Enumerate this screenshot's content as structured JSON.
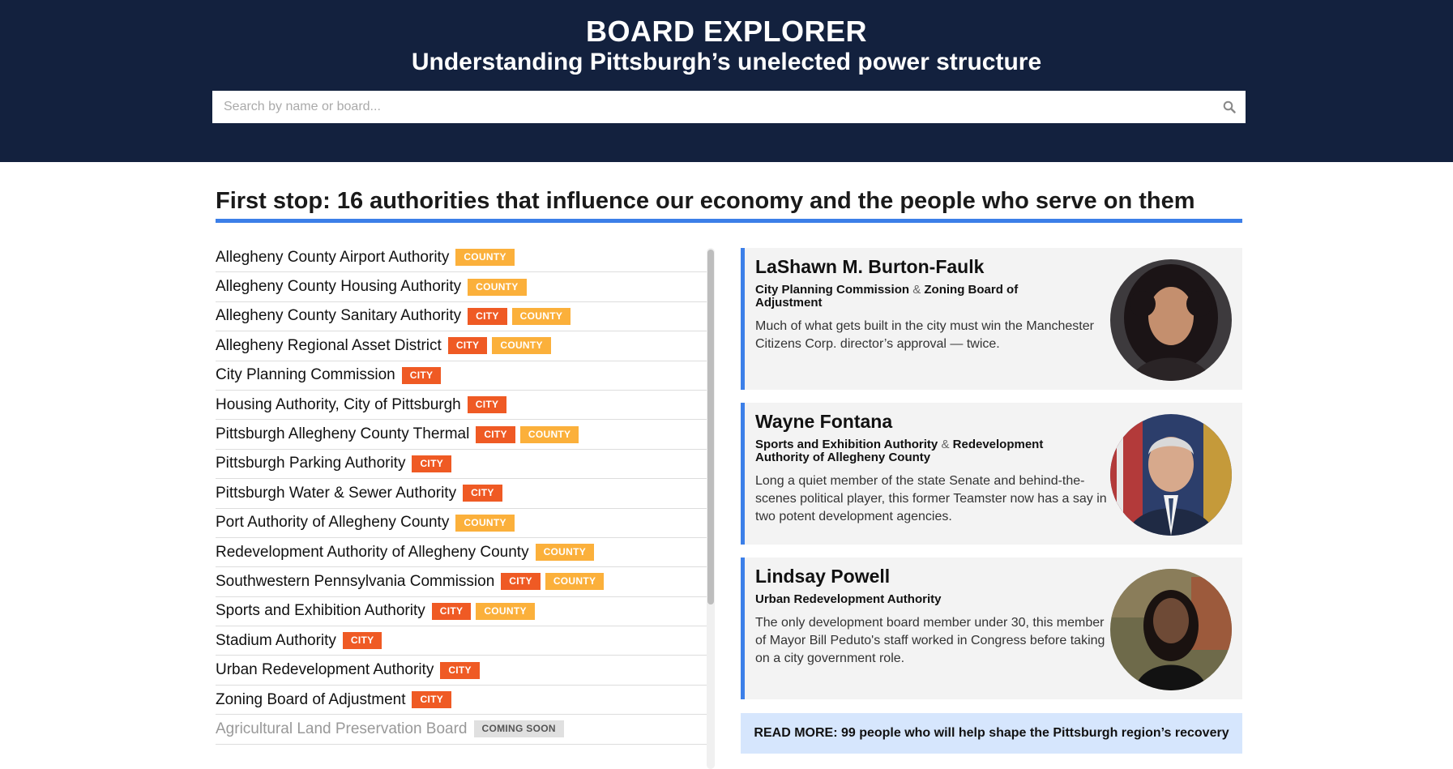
{
  "header": {
    "title": "BOARD EXPLORER",
    "subtitle": "Understanding Pittsburgh’s unelected power structure",
    "search_placeholder": "Search by name or board...",
    "background": "#13213e"
  },
  "section": {
    "heading": "First stop: 16 authorities that influence our economy and the people who serve on them",
    "accent": "#3c7fe8"
  },
  "tag_colors": {
    "city": "#ef5a24",
    "county": "#fbb03b",
    "coming_soon": "#e0e0e0"
  },
  "boards": [
    {
      "name": "Allegheny County Airport Authority",
      "tags": [
        "COUNTY"
      ]
    },
    {
      "name": "Allegheny County Housing Authority",
      "tags": [
        "COUNTY"
      ]
    },
    {
      "name": "Allegheny County Sanitary Authority",
      "tags": [
        "CITY",
        "COUNTY"
      ]
    },
    {
      "name": "Allegheny Regional Asset District",
      "tags": [
        "CITY",
        "COUNTY"
      ]
    },
    {
      "name": "City Planning Commission",
      "tags": [
        "CITY"
      ]
    },
    {
      "name": "Housing Authority, City of Pittsburgh",
      "tags": [
        "CITY"
      ]
    },
    {
      "name": "Pittsburgh Allegheny County Thermal",
      "tags": [
        "CITY",
        "COUNTY"
      ]
    },
    {
      "name": "Pittsburgh Parking Authority",
      "tags": [
        "CITY"
      ]
    },
    {
      "name": "Pittsburgh Water & Sewer Authority",
      "tags": [
        "CITY"
      ]
    },
    {
      "name": "Port Authority of Allegheny County",
      "tags": [
        "COUNTY"
      ]
    },
    {
      "name": "Redevelopment Authority of Allegheny County",
      "tags": [
        "COUNTY"
      ]
    },
    {
      "name": "Southwestern Pennsylvania Commission",
      "tags": [
        "CITY",
        "COUNTY"
      ]
    },
    {
      "name": "Sports and Exhibition Authority",
      "tags": [
        "CITY",
        "COUNTY"
      ]
    },
    {
      "name": "Stadium Authority",
      "tags": [
        "CITY"
      ]
    },
    {
      "name": "Urban Redevelopment Authority",
      "tags": [
        "CITY"
      ]
    },
    {
      "name": "Zoning Board of Adjustment",
      "tags": [
        "CITY"
      ]
    },
    {
      "name": "Agricultural Land Preservation Board",
      "tags": [
        "COMING SOON"
      ],
      "coming_soon": true
    }
  ],
  "people": [
    {
      "name": "LaShawn M. Burton-Faulk",
      "board_1": "City Planning Commission",
      "amp": "&",
      "board_2": "Zoning Board of Adjustment",
      "description": "Much of what gets built in the city must win the Manchester Citizens Corp. director’s approval — twice."
    },
    {
      "name": "Wayne Fontana",
      "board_1": "Sports and Exhibition Authority",
      "amp": "&",
      "board_2": "Redevelopment Authority of Allegheny County",
      "description": "Long a quiet member of the state Senate and behind-the-scenes political player, this former Teamster now has a say in two potent development agencies."
    },
    {
      "name": "Lindsay Powell",
      "board_1": "Urban Redevelopment Authority",
      "amp": "",
      "board_2": "",
      "description": "The only development board member under 30, this member of Mayor Bill Peduto's staff worked in Congress before taking on a city government role."
    }
  ],
  "read_more": {
    "label": "READ MORE: 99 people who will help shape the Pittsburgh region’s recovery"
  }
}
